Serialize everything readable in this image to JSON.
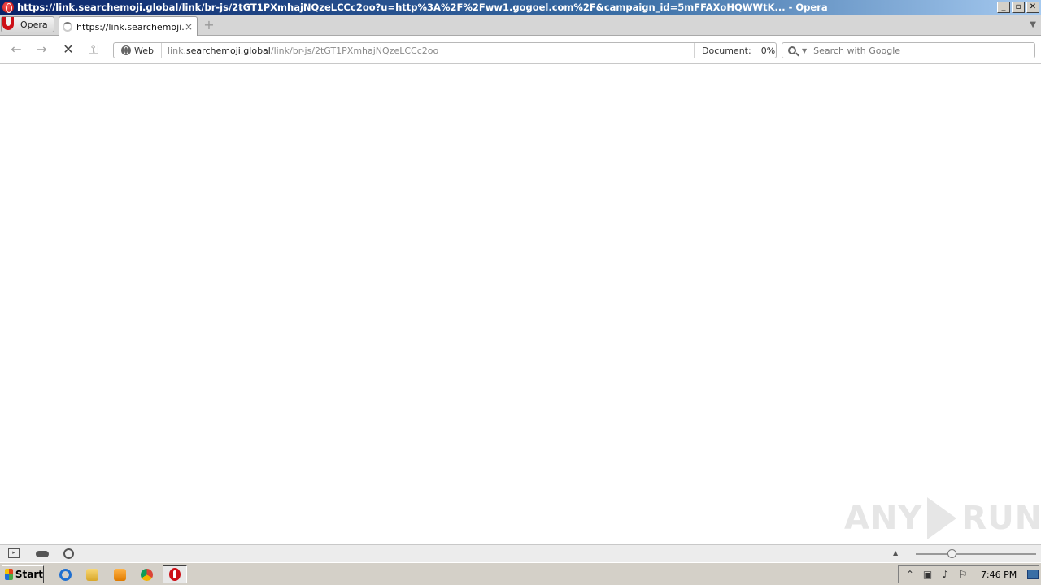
{
  "window": {
    "title": "https://link.searchemoji.global/link/br-js/2tGT1PXmhajNQzeLCCc2oo?u=http%3A%2F%2Fww1.gogoel.com%2F&campaign_id=5mFFAXoHQWWtK... - Opera",
    "controls": {
      "minimize": "_",
      "restore": "▫",
      "close": "✕"
    }
  },
  "tabbar": {
    "menu_label": "Opera",
    "tabs": [
      {
        "title": "https://link.searchemoji.global...",
        "state": "loading"
      }
    ],
    "new_tab": "+",
    "tab_menu": "▼"
  },
  "toolbar": {
    "back_icon": "←",
    "forward_icon": "→",
    "stop_icon": "✕",
    "key_icon": "⚿",
    "site_badge": "Web",
    "url_prefix": "link.",
    "url_host": "searchemoji.global",
    "url_path": "/link/br-js/2tGT1PXmhajNQzeLCCc2oo",
    "document_label": "Document:",
    "document_progress": "0%",
    "search_placeholder": "Search with Google"
  },
  "content": {
    "watermark_left": "ANY",
    "watermark_right": "RUN"
  },
  "statusbar": {
    "zoom_up": "▲",
    "zoom_level": 0.3
  },
  "taskbar": {
    "start_label": "Start",
    "clock": "7:46 PM",
    "tray_icons": [
      "up-arrow-icon",
      "network-icon",
      "volume-icon",
      "flag-icon"
    ],
    "tray_glyphs": [
      "⌃",
      "▣",
      "♪",
      "⚐"
    ]
  }
}
